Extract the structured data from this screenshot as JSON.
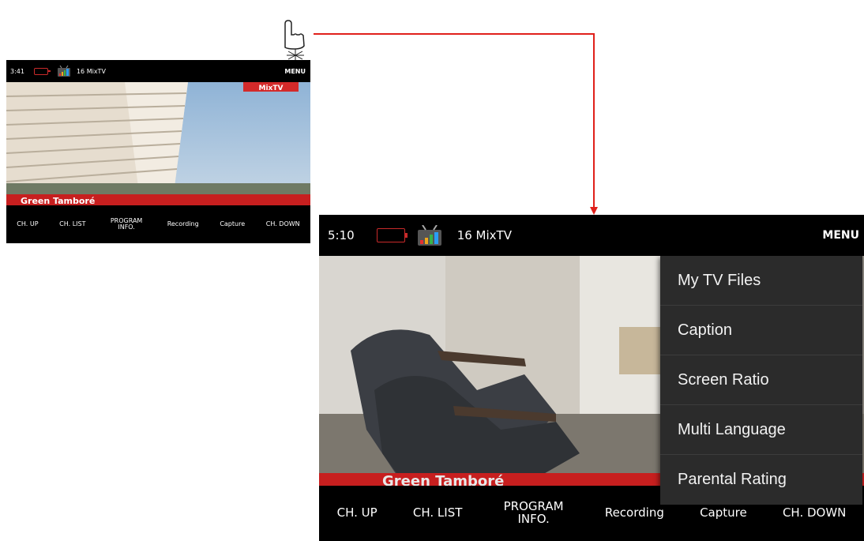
{
  "small_screen": {
    "time": "3:41",
    "channel": "16 MixTV",
    "menu_label": "MENU",
    "video_text": "Green Tamboré",
    "bottom_buttons": [
      "CH. UP",
      "CH. LIST",
      "PROGRAM INFO.",
      "Recording",
      "Capture",
      "CH. DOWN"
    ]
  },
  "large_screen": {
    "time": "5:10",
    "channel": "16 MixTV",
    "menu_label": "MENU",
    "video_text": "Green Tamboré",
    "bottom_buttons": [
      "CH. UP",
      "CH. LIST",
      "PROGRAM INFO.",
      "Recording",
      "Capture",
      "CH. DOWN"
    ],
    "menu_items": [
      "My TV Files",
      "Caption",
      "Screen Ratio",
      "Multi Language",
      "Parental Rating"
    ]
  },
  "colors": {
    "connector": "#e0201b",
    "battery": "#c92a2a",
    "menu_bg": "#2b2b2b"
  },
  "icons": {
    "tap": "tap-hand-icon",
    "tv": "tv-signal-icon",
    "battery": "battery-icon"
  }
}
